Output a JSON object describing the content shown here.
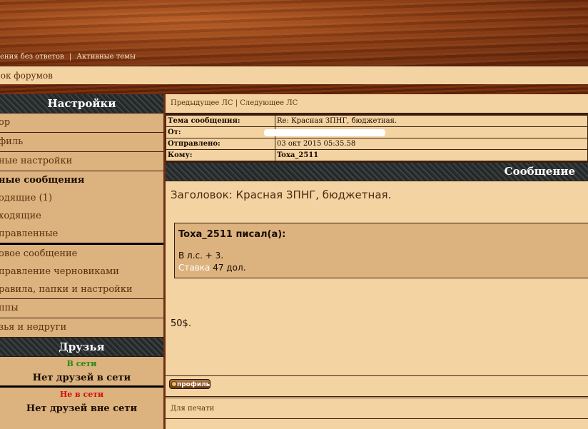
{
  "top_nav": {
    "unanswered": "ения без ответов",
    "separator": "|",
    "active_topics": "Активные темы"
  },
  "breadcrumb": "сок форумов",
  "sidebar": {
    "settings_title": "Настройки",
    "items": [
      "ор",
      "филь",
      "ные настройки",
      "ные сообщения",
      "одящие (1)",
      "ходящие",
      "правленные",
      "овое сообщение",
      "правление черновиками",
      "равила, папки и настройки",
      "ппы",
      "зья и недруги"
    ],
    "friends_title": "Друзья",
    "online_label": "В сети",
    "online_color": "#1f8a12",
    "online_text": "Нет друзей в сети",
    "offline_label": "Не в сети",
    "offline_color": "#d41010",
    "offline_text": "Нет друзей вне сети"
  },
  "main": {
    "prev_pm": "Предыдущее ЛС",
    "sep": "|",
    "next_pm": "Следующее ЛС",
    "subject_label": "Тема сообщения:",
    "subject_value": "Re: Красная ЗПНГ, бюджетная.",
    "from_label": "От:",
    "sent_label": "Отправлено:",
    "sent_value": "03 окт 2015 05:35.58",
    "to_label": "Кому:",
    "to_value": "Toxa_2511",
    "message_title": "Сообщение",
    "message_subject": "Заголовок: Красная ЗПНГ, бюджетная.",
    "quote_author": "Toxa_2511 писал(а):",
    "quote_line1": "В л.с. + 3.",
    "quote_link": "Ставка",
    "quote_line2_rest": " 47 дол.",
    "amount": "50$.",
    "profile_button": "профиль",
    "print_link": "Для печати"
  }
}
